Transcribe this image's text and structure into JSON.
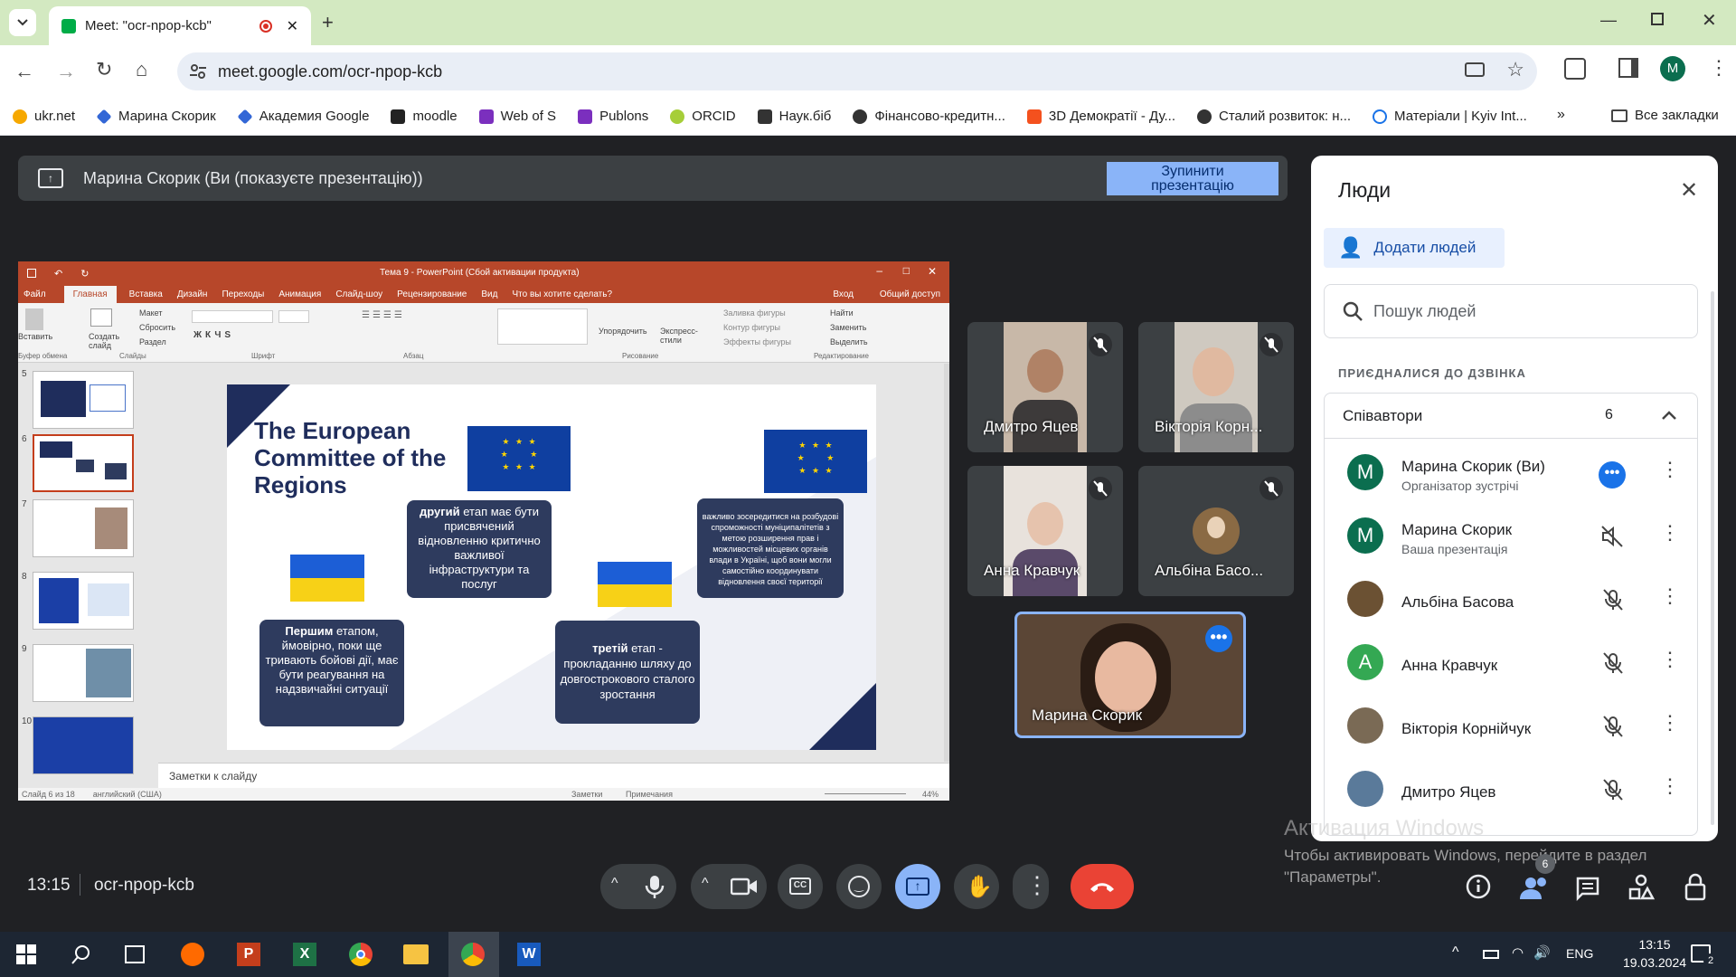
{
  "browser": {
    "tab_title": "Meet: \"ocr-npop-kcb\"",
    "url": "meet.google.com/ocr-npop-kcb",
    "profile_initial": "M",
    "bookmarks": [
      "ukr.net",
      "Марина Скорик",
      "Академия Google",
      "moodle",
      "Web of S",
      "Publons",
      "ORCID",
      "Наук.біб",
      "Фінансово-кредитн...",
      "3D Демократії - Ду...",
      "Сталий розвиток: н...",
      "Матеріали | Kyiv Int..."
    ],
    "all_bookmarks": "Все закладки"
  },
  "banner": {
    "text": "Марина Скорик (Ви (показуєте презентацію))",
    "stop_line1": "Зупинити",
    "stop_line2": "презентацію"
  },
  "powerpoint": {
    "window_title": "Тема 9 - PowerPoint (Сбой активации продукта)",
    "tabs": [
      "Файл",
      "Главная",
      "Вставка",
      "Дизайн",
      "Переходы",
      "Анимация",
      "Слайд-шоу",
      "Рецензирование",
      "Вид",
      "Что вы хотите сделать?"
    ],
    "login": "Вход",
    "share": "Общий доступ",
    "groups": [
      "Буфер обмена",
      "Слайды",
      "Шрифт",
      "Абзац",
      "Рисование",
      "Редактирование"
    ],
    "ribbon_items": [
      "Вставить",
      "Создать слайд",
      "Макет",
      "Сбросить",
      "Раздел",
      "Упорядочить",
      "Экспресс-стили",
      "Заливка фигуры",
      "Контур фигуры",
      "Эффекты фигуры",
      "Найти",
      "Заменить",
      "Выделить"
    ],
    "thumb_numbers": [
      "5",
      "6",
      "7",
      "8",
      "9",
      "10"
    ],
    "notes_placeholder": "Заметки к слайду",
    "status_left": "Слайд 6 из 18",
    "status_lang": "английский (США)",
    "status_notes": "Заметки",
    "status_comments": "Примечания",
    "zoom": "44%"
  },
  "slide": {
    "title": "The European Committee of the Regions",
    "box1_bold": "Першим",
    "box1_rest": " етапом, ймовірно, поки ще тривають бойові дії, має бути реагування на надзвичайні ситуації",
    "box2_bold": "другий",
    "box2_rest": " етап має бути присвячений відновленню критично важливої інфраструктури та послуг",
    "box3_bold": "третій",
    "box3_rest": " етап - прокладанню шляху до довгострокового сталого зростання",
    "box4": "важливо зосередитися на розбудові спроможності муніципалітетів з метою розширення прав і можливостей місцевих органів влади в Україні, щоб вони могли самостійно координувати відновлення своєї території"
  },
  "tiles": [
    {
      "name": "Дмитро Яцев"
    },
    {
      "name": "Вікторія Корн..."
    },
    {
      "name": "Анна Кравчук"
    },
    {
      "name": "Альбіна Басо..."
    },
    {
      "name": "Марина Скорик"
    }
  ],
  "people": {
    "title": "Люди",
    "add_people": "Додати людей",
    "search_placeholder": "Пошук людей",
    "joined": "ПРИЄДНАЛИСЯ ДО ДЗВІНКА",
    "group_label": "Співавтори",
    "group_count": "6",
    "list": [
      {
        "name": "Марина Скорик (Ви)",
        "sub": "Організатор зустрічі",
        "initial": "M"
      },
      {
        "name": "Марина Скорик",
        "sub": "Ваша презентація",
        "initial": "M"
      },
      {
        "name": "Альбіна Басова",
        "sub": "",
        "initial": ""
      },
      {
        "name": "Анна Кравчук",
        "sub": "",
        "initial": "A"
      },
      {
        "name": "Вікторія Корнійчук",
        "sub": "",
        "initial": ""
      },
      {
        "name": "Дмитро Яцев",
        "sub": "",
        "initial": ""
      }
    ]
  },
  "watermark": {
    "title": "Активация Windows",
    "line1": "Чтобы активировать Windows, перейдите в раздел",
    "line2": "\"Параметры\"."
  },
  "meeting": {
    "time": "13:15",
    "code": "ocr-npop-kcb",
    "people_badge": "6"
  },
  "taskbar": {
    "lang": "ENG",
    "time": "13:15",
    "date": "19.03.2024",
    "notif": "2"
  },
  "colors": {
    "accent": "#8ab4f8",
    "hangup": "#ea4335",
    "ppt": "#b7472a",
    "slide_box": "#2e3b5e"
  }
}
